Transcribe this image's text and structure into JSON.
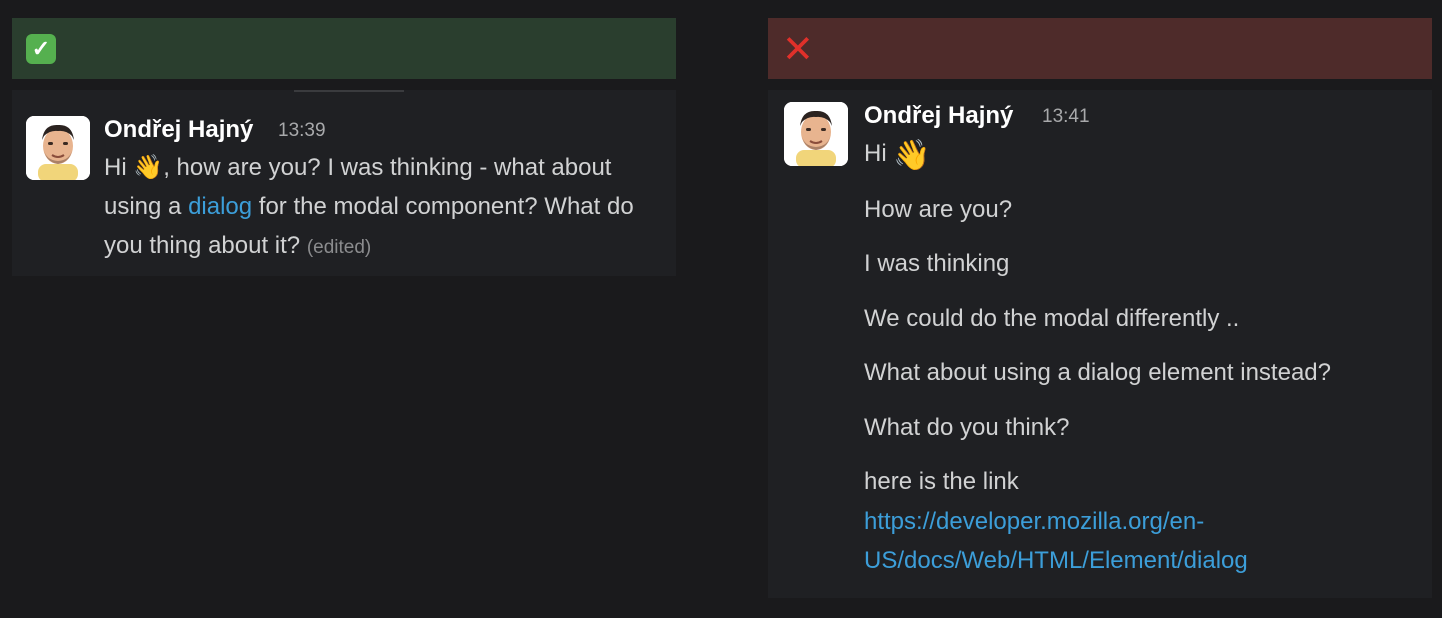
{
  "good_example": {
    "status_icon": "check-mark-icon",
    "message": {
      "author": "Ondřej Hajný",
      "time": "13:39",
      "text_before_link": "Hi 👋, how are you? I was thinking - what about using a ",
      "link_text": "dialog",
      "text_after_link": " for the modal component? What do you thing about it? ",
      "edited_label": "(edited)"
    }
  },
  "bad_example": {
    "status_icon": "cross-mark-icon",
    "message": {
      "author": "Ondřej Hajný",
      "time": "13:41",
      "greeting": "Hi",
      "greeting_emoji": "👋",
      "lines": [
        "How are you?",
        "I was thinking",
        "We could do the modal differently ..",
        "What about using a dialog element instead?",
        "What do you think?",
        "here is the link"
      ],
      "url_line_1": "https://developer.mozilla.org/en-",
      "url_line_2": "US/docs/Web/HTML/Element/dialog"
    }
  },
  "colors": {
    "background": "#1a1a1c",
    "card": "#1f2023",
    "good_banner": "#2a3e2e",
    "bad_banner": "#4e2b2a",
    "link": "#3c9ed9"
  }
}
